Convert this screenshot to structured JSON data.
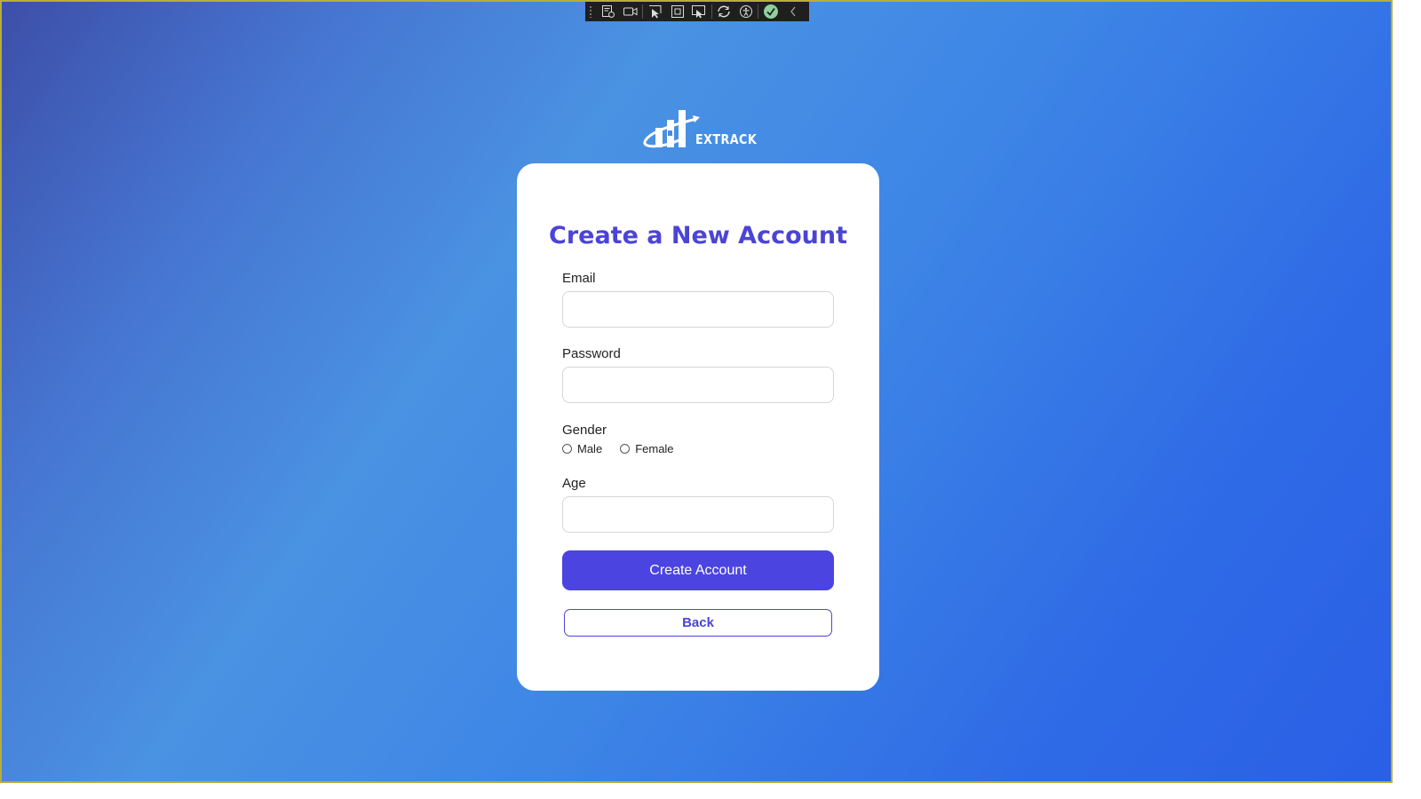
{
  "brand": {
    "name": "EXTRACK"
  },
  "debug_toolbar": {
    "items": [
      {
        "icon": "live-visual-tree-icon"
      },
      {
        "icon": "video-camera-icon"
      },
      {
        "icon": "select-element-icon"
      },
      {
        "icon": "display-layout-adorners-icon"
      },
      {
        "icon": "track-focused-element-icon"
      },
      {
        "icon": "hot-reload-icon"
      },
      {
        "icon": "accessibility-icon"
      },
      {
        "icon": "status-ok-icon"
      },
      {
        "icon": "collapse-chevron-icon"
      }
    ]
  },
  "form": {
    "title": "Create a New Account",
    "email_label": "Email",
    "email_value": "",
    "password_label": "Password",
    "password_value": "",
    "gender_label": "Gender",
    "gender_options": [
      "Male",
      "Female"
    ],
    "age_label": "Age",
    "age_value": "",
    "submit_label": "Create Account",
    "back_label": "Back"
  },
  "colors": {
    "accent": "#4b44e0",
    "title": "#4b44d6",
    "background_start": "#3d4fa8",
    "background_end": "#2a5fe6",
    "card": "#ffffff"
  }
}
